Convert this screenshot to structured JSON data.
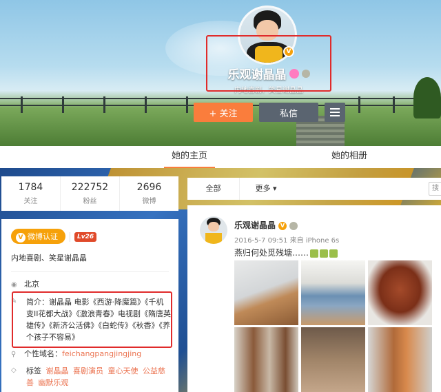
{
  "header": {
    "name": "乐观谢晶晶",
    "subtitle": "内地喜剧、笑星谢晶晶",
    "verified_mark": "V",
    "follow_label": "+ 关注",
    "message_label": "私信"
  },
  "tabs": [
    {
      "label": "她的主页",
      "active": true
    },
    {
      "label": "她的相册",
      "active": false
    }
  ],
  "stats": [
    {
      "value": "1784",
      "label": "关注"
    },
    {
      "value": "222752",
      "label": "粉丝"
    },
    {
      "value": "2696",
      "label": "微博"
    }
  ],
  "profile": {
    "verify_label": "微博认证",
    "verify_mark": "V",
    "level": "Lv26",
    "description": "内地喜剧、笑星谢晶晶",
    "location_icon": "location-pin-icon",
    "location": "北京",
    "bio": "简介：谢晶晶 电影《西游·降魔篇》《千机变II花都大战》《激浪青春》电视剧《隋唐英雄传》《新济公活佛》《白蛇传》《秋香》《养个孩子不容易》",
    "domain_label": "个性域名：",
    "domain": "feichangpangjingjing",
    "tags_label": "标签",
    "tags": [
      "谢晶晶",
      "喜剧演员",
      "童心天使",
      "公益慈善",
      "幽默乐观"
    ]
  },
  "feed": {
    "tab_all": "全部",
    "tab_more": "更多 ▾",
    "search_placeholder": "搜"
  },
  "post": {
    "author": "乐观谢晶晶",
    "verified_mark": "V",
    "meta": "2016-5-7 09:51 来自 iPhone 6s",
    "text": "燕归何处觅残塘……"
  },
  "colors": {
    "accent": "#fa7d3c",
    "verified": "#f6a10a",
    "highlight_box": "#e02b2b",
    "link": "#eb7350"
  }
}
